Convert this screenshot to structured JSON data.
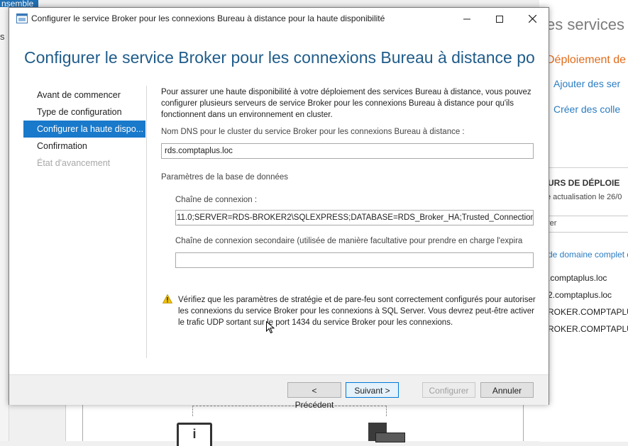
{
  "background": {
    "ensemble_label": "nsemble",
    "side_letter": "s",
    "title": "es services B",
    "deployment_heading": "Déploiement de",
    "link_add": "Ajouter des ser",
    "link_create": "Créer des colle",
    "servers_title": "URS DE DÉPLOIE",
    "refresh_text": "e actualisation le 26/0",
    "filter_text": "rer",
    "col_header": "de domaine complet d",
    "rows": [
      ".comptaplus.loc",
      "2.comptaplus.loc",
      "ROKER.COMPTAPLUS",
      "ROKER.COMPTAPLUS"
    ],
    "info_icon_glyph": "i"
  },
  "window": {
    "title": "Configurer le service Broker pour les connexions Bureau à distance pour la haute disponibilité",
    "icon": "server-manager-icon"
  },
  "header": {
    "title": "Configurer le service Broker pour les connexions Bureau à distance po..."
  },
  "nav": {
    "items": [
      {
        "label": "Avant de commencer",
        "state": "normal"
      },
      {
        "label": "Type de configuration",
        "state": "normal"
      },
      {
        "label": "Configurer la haute dispo...",
        "state": "active"
      },
      {
        "label": "Confirmation",
        "state": "normal"
      },
      {
        "label": "État d'avancement",
        "state": "disabled"
      }
    ]
  },
  "content": {
    "intro": "Pour assurer une haute disponibilité à votre déploiement des services Bureau à distance, vous pouvez configurer plusieurs serveurs de service Broker pour les connexions Bureau à distance pour qu'ils fonctionnent dans un environnement en cluster.",
    "dns_label": "Nom DNS pour le cluster du service Broker pour les connexions Bureau à distance :",
    "dns_value": "rds.comptaplus.loc",
    "db_section": "Paramètres de la base de données",
    "conn_label": "Chaîne de connexion :",
    "conn_value": "11.0;SERVER=RDS-BROKER2\\SQLEXPRESS;DATABASE=RDS_Broker_HA;Trusted_Connection=Yes;",
    "secondary_label": "Chaîne de connexion secondaire (utilisée de manière facultative pour prendre en charge l'expira",
    "secondary_value": "",
    "warning": "Vérifiez que les paramètres de stratégie et de pare-feu sont correctement configurés pour autoriser les connexions du service Broker pour les connexions à SQL Server. Vous devrez peut-être activer le trafic UDP sortant sur le port 1434 du service Broker pour les connexions."
  },
  "footer": {
    "prev": "< Précédent",
    "next": "Suivant >",
    "configure": "Configurer",
    "cancel": "Annuler"
  },
  "colors": {
    "accent": "#1979ca",
    "header_blue": "#1f5c8a",
    "link_blue": "#2a7cc1",
    "orange": "#e06c1c",
    "warning_yellow": "#f2c200"
  }
}
